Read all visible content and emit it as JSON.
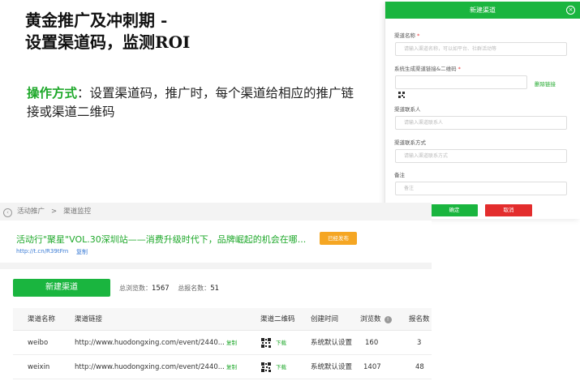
{
  "slide": {
    "title_line1": "黄金推广及冲刺期 -",
    "title_line2": "设置渠道码，监测ROI",
    "method_label": "操作方式",
    "method_text": "：设置渠道码，推广时，每个渠道给相应的推广链接或渠道二维码"
  },
  "dialog": {
    "title": "新建渠道",
    "close_icon": "close-icon",
    "fields": {
      "name": {
        "label": "渠道名称",
        "required": "*",
        "placeholder": "请输入渠道名称，可以如平台、社群活动等"
      },
      "code": {
        "label": "系统生成渠道链接&二维码",
        "required": "*",
        "edit": "删除链接"
      },
      "contact": {
        "label": "渠道联系人",
        "placeholder": "请输入渠道联系人"
      },
      "contact_method": {
        "label": "渠道联系方式",
        "placeholder": "请输入渠道联系方式"
      },
      "note": {
        "label": "备注",
        "placeholder": "备注"
      }
    },
    "ok": "确定",
    "cancel": "取消"
  },
  "app": {
    "breadcrumb": {
      "back_icon": "back-arrow-icon",
      "item1": "活动推广",
      "sep": ">",
      "item2": "渠道监控"
    },
    "event": {
      "title": "活动行\"聚星\"VOL.30深圳站——消费升级时代下，品牌崛起的机会在哪...",
      "badge": "已经发布",
      "url": "http://t.cn/R39tFrn",
      "copy": "复制"
    },
    "new_button": "新建渠道",
    "stats": {
      "views_label": "总浏览数：",
      "views": "1567",
      "signups_label": "总报名数：",
      "signups": "51"
    },
    "table": {
      "headers": {
        "name": "渠道名称",
        "link": "渠道链接",
        "qr": "渠道二维码",
        "time": "创建时间",
        "views": "浏览数",
        "signups": "报名数"
      },
      "rows": [
        {
          "name": "weibo",
          "link": "http://www.huodongxing.com/event/2440...",
          "copy": "复制",
          "download": "下载",
          "time": "系统默认设置",
          "views": "160",
          "signups": "3"
        },
        {
          "name": "weixin",
          "link": "http://www.huodongxing.com/event/2440...",
          "copy": "复制",
          "download": "下载",
          "time": "系统默认设置",
          "views": "1407",
          "signups": "48"
        }
      ]
    }
  },
  "colors": {
    "brand_green": "#1ab53f",
    "cancel_red": "#e32d2d",
    "badge_orange": "#f5a623"
  }
}
